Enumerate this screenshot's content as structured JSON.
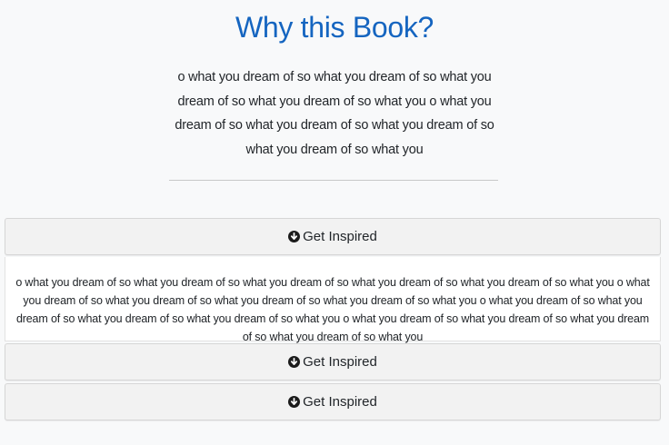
{
  "section": {
    "title": "Why this Book?",
    "intro": "o what you dream of so what you dream of so what you dream of so what you dream of so what you o what you dream of so what you dream of so what you dream of so what you dream of so what you"
  },
  "accordion": {
    "items": [
      {
        "label": "Get Inspired",
        "icon": "circle-arrow-down-icon",
        "expanded": true,
        "body": "o what you dream of so what you dream of so what you dream of so what you dream of so what you dream of so what you o what you dream of so what you dream of so what you dream of so what you dream of so what you o what you dream of so what you dream of so what you dream of so what you dream of so what you o what you dream of so what you dream of so what you dream of so what you dream of so what you"
      },
      {
        "label": "Get Inspired",
        "icon": "circle-arrow-down-icon",
        "expanded": false
      },
      {
        "label": "Get Inspired",
        "icon": "circle-arrow-down-icon",
        "expanded": false
      }
    ]
  },
  "colors": {
    "title": "#1565c0",
    "background": "#f8f9fa",
    "header_background": "#f2f2f2"
  }
}
